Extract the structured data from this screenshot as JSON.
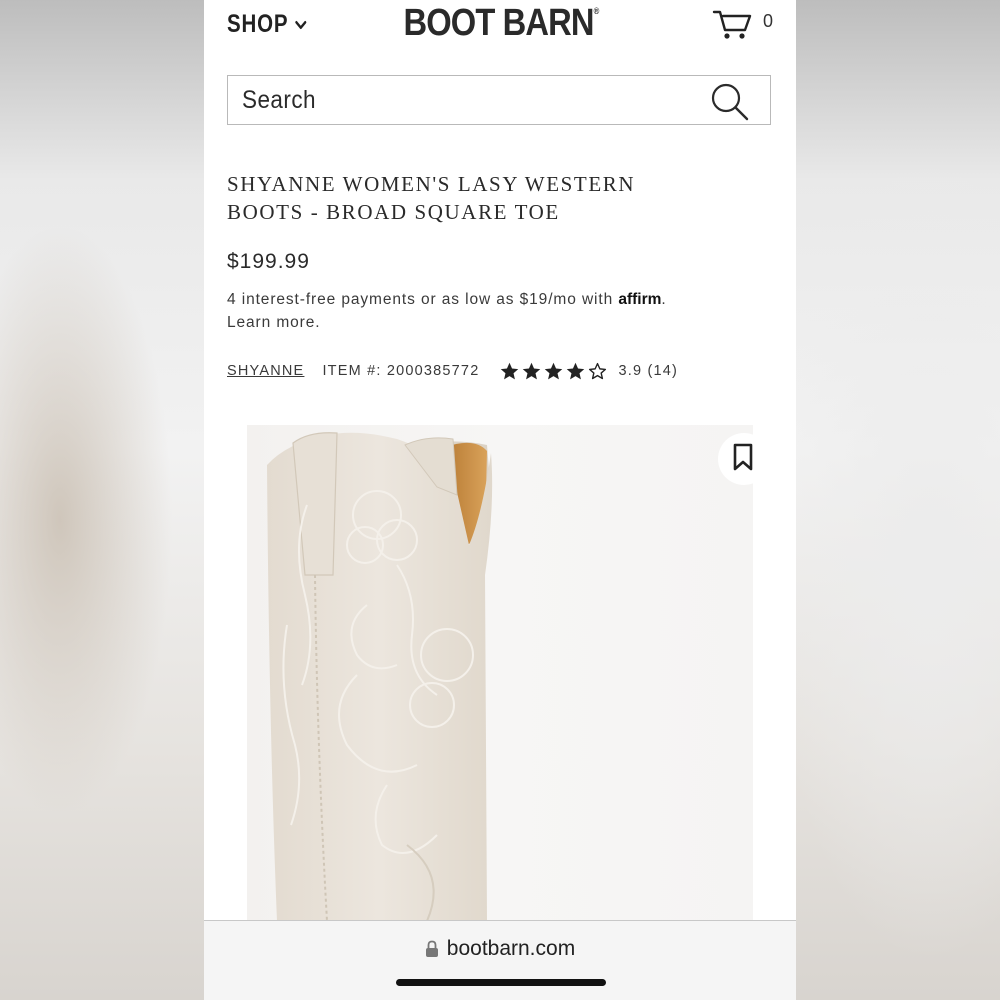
{
  "header": {
    "shop_label": "SHOP",
    "logo": "BOOT BARN",
    "logo_mark": "®",
    "cart_count": "0"
  },
  "search": {
    "placeholder": "Search"
  },
  "product": {
    "title_line1": "SHYANNE WOMEN'S LASY WESTERN",
    "title_line2": "BOOTS - BROAD SQUARE TOE",
    "price": "$199.99",
    "financing_text": "4 interest-free payments or as low as $19/mo with",
    "financing_brand": "affirm",
    "financing_end": ".",
    "learn_more": "Learn more.",
    "brand": "SHYANNE",
    "item_number": "ITEM #: 2000385772",
    "rating": 3.9,
    "rating_text": "3.9 (14)",
    "stars_filled": 4,
    "stars_total": 5
  },
  "browser": {
    "url": "bootbarn.com"
  },
  "colors": {
    "text": "#2a2a2a",
    "boot": "#e8e1d8",
    "boot_lining": "#c8893e",
    "image_bg": "#f5f4f3"
  }
}
